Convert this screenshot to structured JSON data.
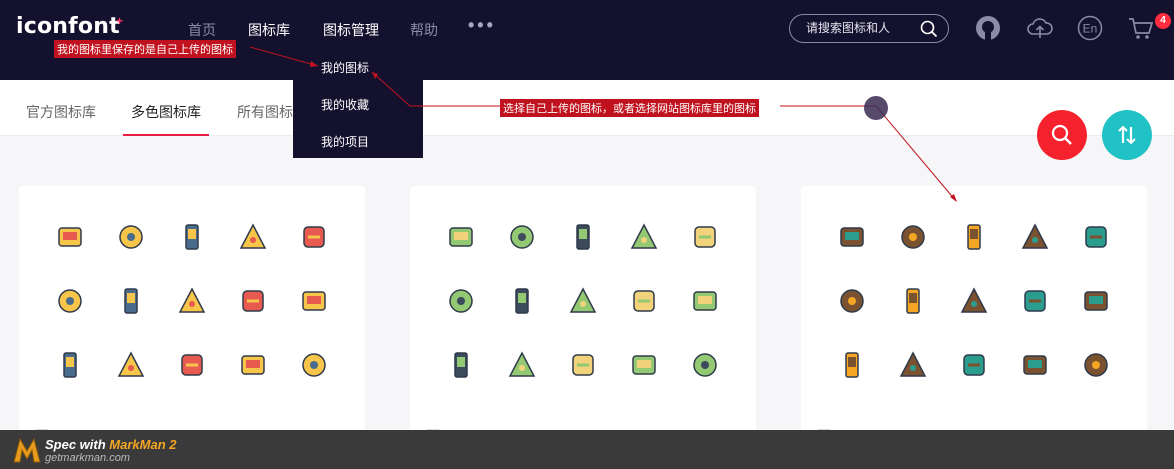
{
  "brand": {
    "logo_text": "iconfont",
    "logo_plus": "+"
  },
  "topnav": {
    "items": [
      "首页",
      "图标库",
      "图标管理",
      "帮助"
    ],
    "more": "•••",
    "search_placeholder": "请搜索图标和人",
    "icons": [
      "github-icon",
      "cloud-upload-icon",
      "language-en-icon",
      "cart-icon"
    ],
    "lang_label": "En",
    "cart_count": "4"
  },
  "dropdown": {
    "items": [
      "我的图标",
      "我的收藏",
      "我的项目"
    ]
  },
  "subnav": {
    "items": [
      "官方图标库",
      "多色图标库",
      "所有图标"
    ]
  },
  "annotations": {
    "note1": "我的图标里保存的是自己上传的图标",
    "note2": "选择自己上传的图标，或者选择网站图标库里的图标"
  },
  "cards": [
    {
      "icons": [
        "megaphone-icon",
        "jar-icon",
        "phone-app-icon",
        "video-player-icon",
        "eyedropper-icon",
        "lockers-icon",
        "milk-carton-icon",
        "newspaper-icon",
        "graduation-cap-icon",
        "notebook-icon",
        "notepad-icon",
        "compass-icon",
        "pen-icon",
        "paper-plane-icon",
        "padlock-icon"
      ]
    },
    {
      "icons": [
        "soccer-field-icon",
        "treadmill-icon",
        "skateboard-icon",
        "baseball-bat-icon",
        "chess-rook-icon",
        "football-icon",
        "basketball-court-icon",
        "ping-pong-icon",
        "basketball-hoop-icon",
        "kayak-icon",
        "water-bottle-icon",
        "helmet-icon",
        "boxing-glove-icon",
        "trophy-cup-icon",
        "flippers-icon"
      ]
    },
    {
      "icons": [
        "anteater-icon",
        "bat-icon",
        "beetle-icon",
        "butterfly-icon",
        "camel-icon",
        "bear-icon",
        "cat-icon",
        "chameleon-icon",
        "clownfish-icon",
        "cow-icon",
        "cobra-icon",
        "crocodile-icon",
        "chicken-icon",
        "frog-icon",
        "giraffe-icon"
      ]
    }
  ],
  "markman": {
    "title_prefix": "Spec with ",
    "title_accent": "MarkMan 2",
    "url": "getmarkman.com"
  }
}
